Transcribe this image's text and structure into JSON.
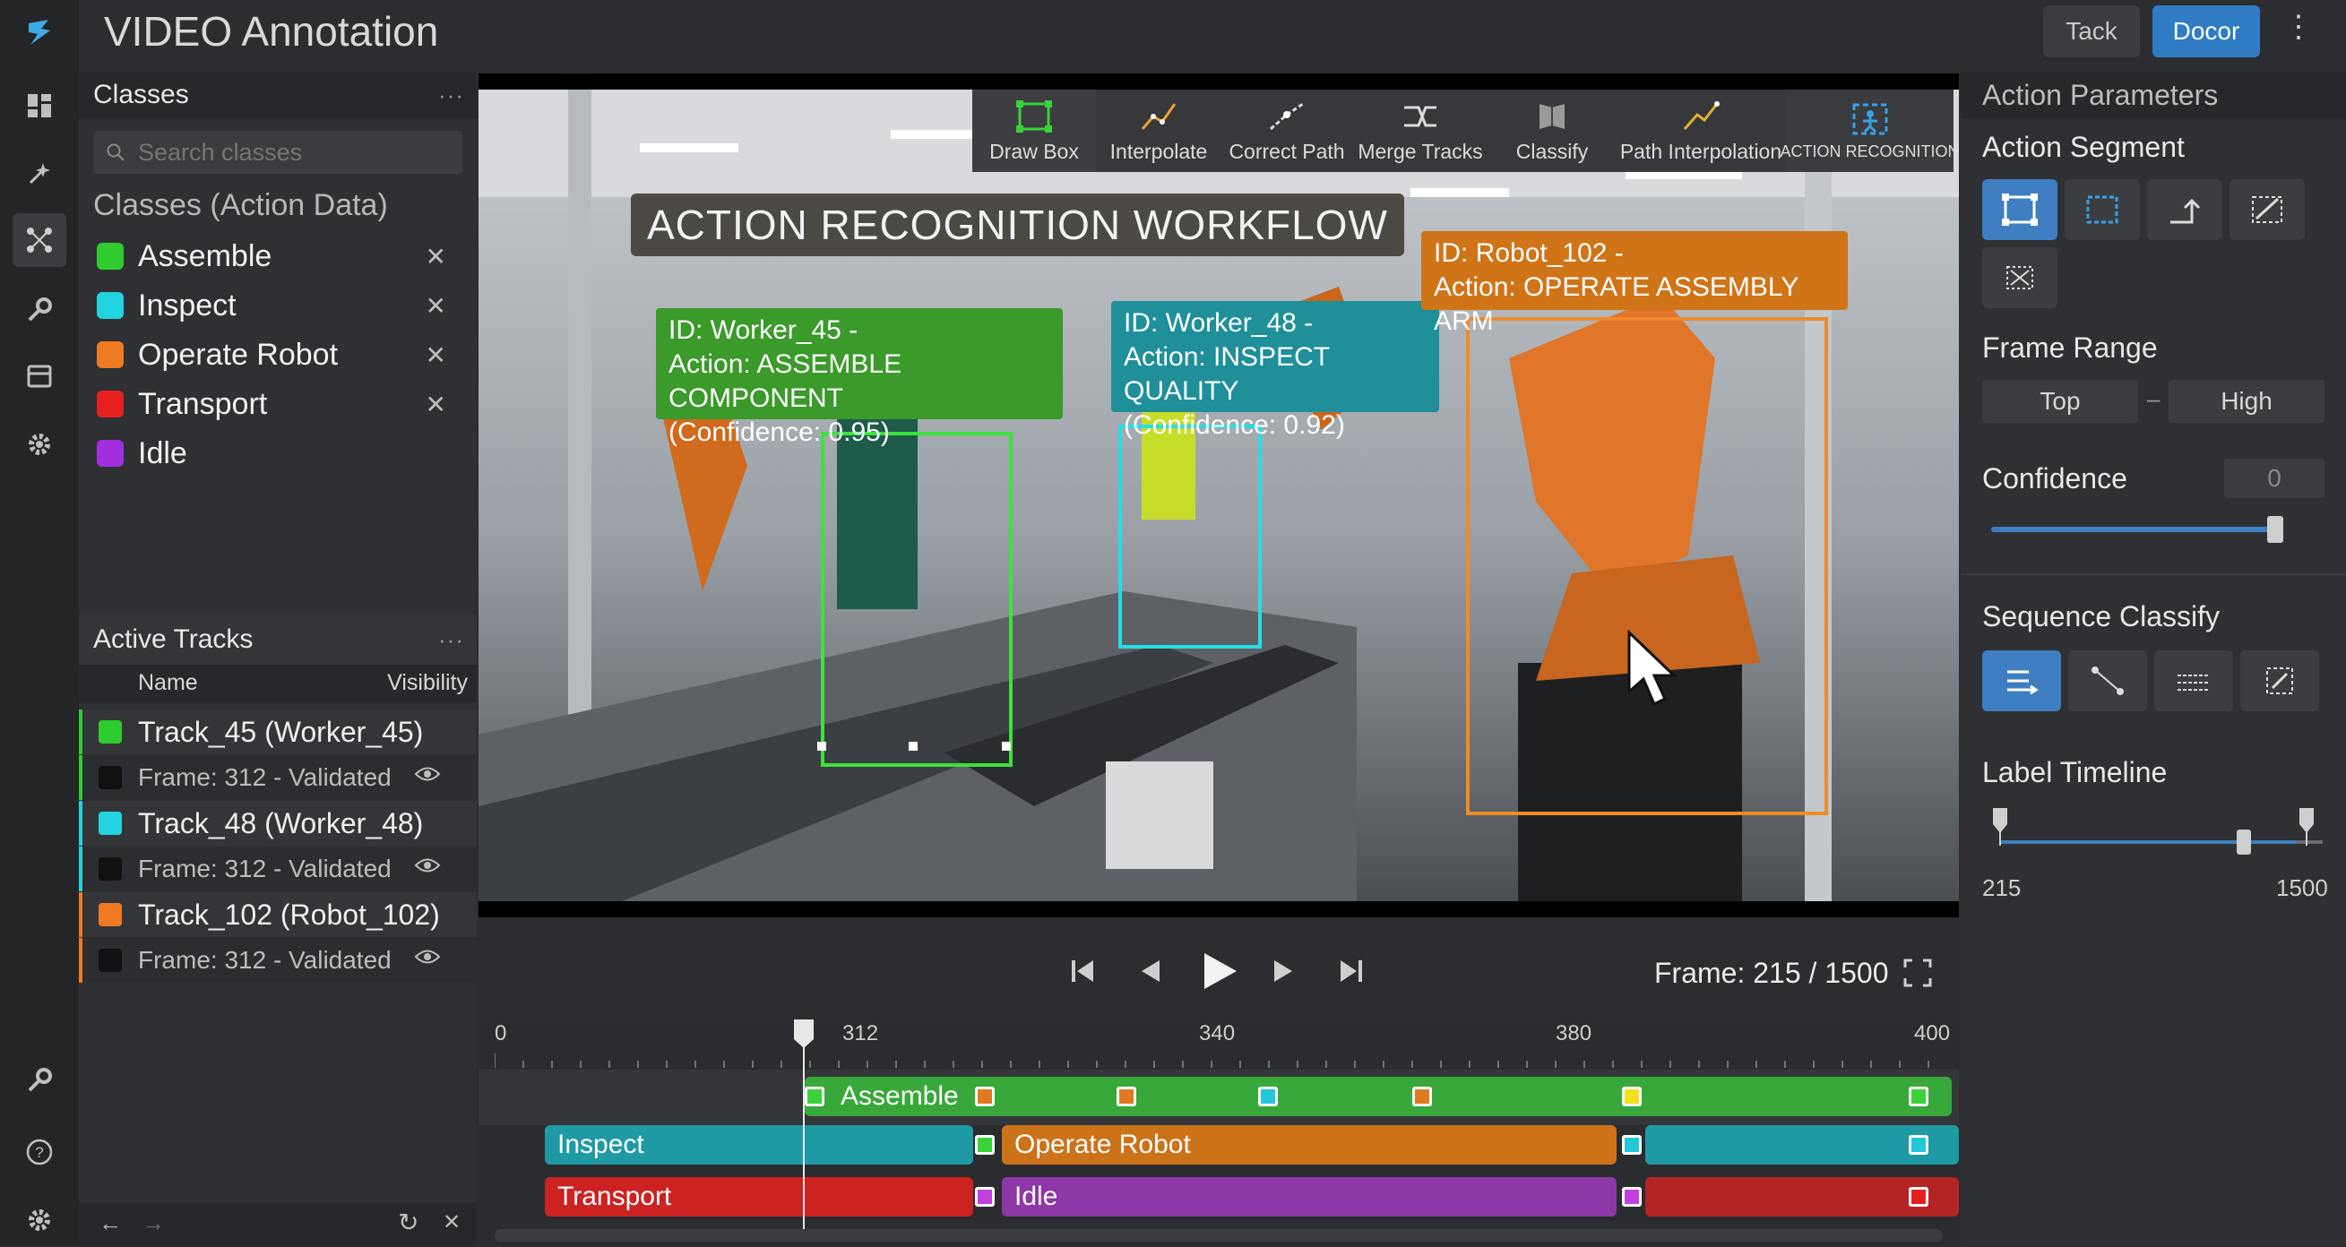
{
  "app": {
    "title": "VIDEO Annotation",
    "buttons": {
      "secondary": "Tack",
      "primary": "Docor"
    }
  },
  "left_panel": {
    "classes_title": "Classes",
    "search_placeholder": "Search classes",
    "section_title": "Classes (Action Data)",
    "classes": [
      {
        "label": "Assemble",
        "color": "#2ecc2e"
      },
      {
        "label": "Inspect",
        "color": "#22d3e0"
      },
      {
        "label": "Operate Robot",
        "color": "#f07a22"
      },
      {
        "label": "Transport",
        "color": "#e62020"
      },
      {
        "label": "Idle",
        "color": "#a12fe0"
      }
    ],
    "tracks_title": "Active Tracks",
    "tracks_columns": {
      "name": "Name",
      "visibility": "Visibility"
    },
    "tracks": [
      {
        "name": "Track_45 (Worker_45)",
        "status": "Frame: 312 - Validated",
        "color": "#2ecc2e"
      },
      {
        "name": "Track_48 (Worker_48)",
        "status": "Frame: 312 - Validated",
        "color": "#22d3e0"
      },
      {
        "name": "Track_102 (Robot_102)",
        "status": "Frame: 312 - Validated",
        "color": "#f07a22"
      }
    ]
  },
  "toolbar": {
    "tools": [
      {
        "label": "Draw Box",
        "icon": "draw-box-icon"
      },
      {
        "label": "Interpolate",
        "icon": "interpolate-icon"
      },
      {
        "label": "Correct Path",
        "icon": "correct-path-icon"
      },
      {
        "label": "Merge Tracks",
        "icon": "merge-tracks-icon"
      },
      {
        "label": "Classify",
        "icon": "classify-icon"
      },
      {
        "label": "Path Interpolation",
        "icon": "path-interpolation-icon"
      },
      {
        "label": "ACTION RECOGNITION",
        "icon": "action-recognition-icon"
      }
    ]
  },
  "video": {
    "banner": "ACTION RECOGNITION WORKFLOW",
    "annotations": [
      {
        "id": "ID: Worker_45 -",
        "action": "Action: ASSEMBLE COMPONENT",
        "confidence": "(Confidence: 0.95)",
        "color": "#3a9a2a"
      },
      {
        "id": "ID: Worker_48 -",
        "action": "Action: INSPECT QUALITY",
        "confidence": "(Confidence: 0.92)",
        "color": "#1f8f9a"
      },
      {
        "id": "ID: Robot_102 -",
        "action": "Action: OPERATE ASSEMBLY ARM",
        "color": "#d07418"
      }
    ]
  },
  "playback": {
    "frame_text": "Frame: 215 / 1500"
  },
  "timeline": {
    "ticks": [
      "0",
      "312",
      "340",
      "380",
      "400"
    ],
    "rows": [
      [
        {
          "label": "Assemble",
          "color": "#38a83a"
        }
      ],
      [
        {
          "label": "Inspect",
          "color": "#1f9aa5"
        },
        {
          "label": "Operate Robot",
          "color": "#cc7219"
        },
        {
          "label": "",
          "color": "#1f9aa5"
        }
      ],
      [
        {
          "label": "Transport",
          "color": "#cc2222"
        },
        {
          "label": "Idle",
          "color": "#8e37a6"
        },
        {
          "label": "",
          "color": "#b52424"
        }
      ]
    ]
  },
  "right_panel": {
    "title": "Action Parameters",
    "segment_title": "Action Segment",
    "frame_range_title": "Frame Range",
    "frame_range": {
      "from": "Top",
      "separator": "–",
      "to": "High"
    },
    "confidence_title": "Confidence",
    "confidence_value": "0",
    "sequence_title": "Sequence Classify",
    "label_timeline_title": "Label Timeline",
    "label_timeline": {
      "min": "215",
      "max": "1500"
    }
  }
}
